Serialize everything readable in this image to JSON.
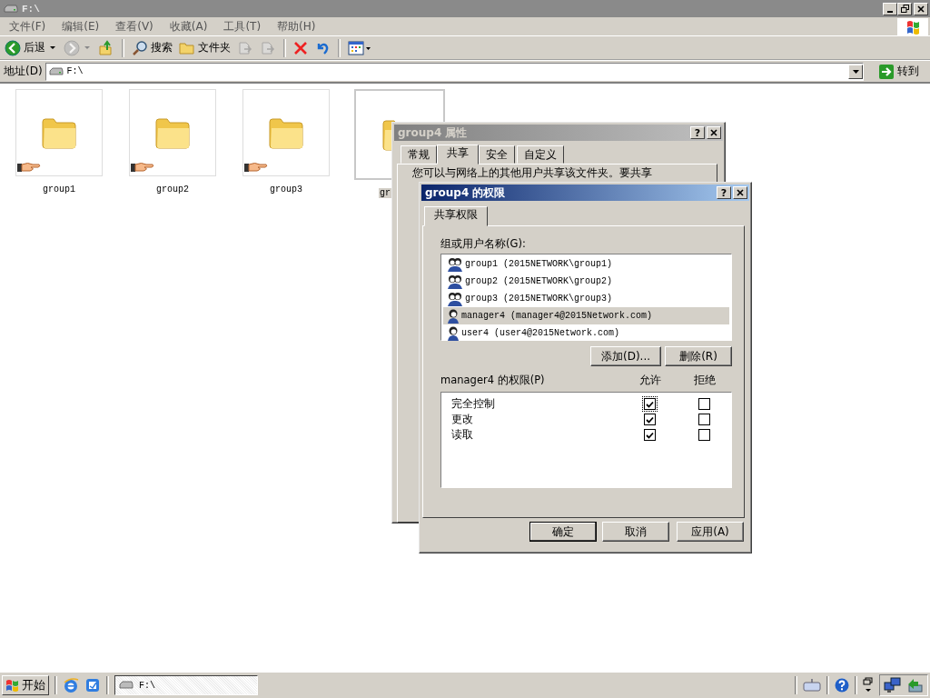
{
  "window": {
    "title": "F:\\"
  },
  "menu": [
    "文件(F)",
    "编辑(E)",
    "查看(V)",
    "收藏(A)",
    "工具(T)",
    "帮助(H)"
  ],
  "toolbar": [
    {
      "kind": "back",
      "label": "后退",
      "disabled": false
    },
    {
      "kind": "forward",
      "disabled": true
    },
    {
      "kind": "up",
      "disabled": false
    },
    {
      "kind": "search",
      "label": "搜索",
      "disabled": false
    },
    {
      "kind": "folders",
      "label": "文件夹",
      "disabled": false
    },
    {
      "kind": "move",
      "disabled": true
    },
    {
      "kind": "copy",
      "disabled": true
    },
    {
      "kind": "delete",
      "disabled": false
    },
    {
      "kind": "undo",
      "disabled": false
    },
    {
      "kind": "views",
      "disabled": false
    }
  ],
  "address": {
    "label": "地址(D)",
    "value": "F:\\",
    "go": "转到"
  },
  "folders": [
    {
      "name": "group1",
      "shared": true,
      "selected": false
    },
    {
      "name": "group2",
      "shared": true,
      "selected": false
    },
    {
      "name": "group3",
      "shared": true,
      "selected": false
    },
    {
      "name": "gr",
      "selected": true
    }
  ],
  "properties": {
    "title": "group4 属性",
    "help": "?",
    "tabs": [
      {
        "label": "常规",
        "selected": false
      },
      {
        "label": "共享",
        "selected": true
      },
      {
        "label": "安全",
        "selected": false
      },
      {
        "label": "自定义",
        "selected": false
      }
    ],
    "text": "您可以与网络上的其他用户共享该文件夹。要共享"
  },
  "permissions": {
    "title": "group4 的权限",
    "help": "?",
    "tabs": [
      {
        "label": "共享权限",
        "selected": true
      }
    ],
    "group_label": "组或用户名称(G):",
    "principals": [
      {
        "name": "group1  (2015NETWORK\\group1)",
        "kind": "group",
        "selected": false
      },
      {
        "name": "group2  (2015NETWORK\\group2)",
        "kind": "group",
        "selected": false
      },
      {
        "name": "group3  (2015NETWORK\\group3)",
        "kind": "group",
        "selected": false
      },
      {
        "name": "manager4  (manager4@2015Network.com)",
        "kind": "user",
        "selected": true
      },
      {
        "name": "user4  (user4@2015Network.com)",
        "kind": "user",
        "selected": false
      }
    ],
    "add": "添加(D)...",
    "remove": "删除(R)",
    "perm_label": "manager4 的权限(P)",
    "allow_header": "允许",
    "deny_header": "拒绝",
    "perms": [
      {
        "name": "完全控制",
        "allow": true,
        "deny": false
      },
      {
        "name": "更改",
        "allow": true,
        "deny": false
      },
      {
        "name": "读取",
        "allow": true,
        "deny": false
      }
    ],
    "buttons": [
      "确定",
      "取消",
      "应用(A)"
    ]
  },
  "taskbar": {
    "start": "开始",
    "task": "F:\\"
  }
}
